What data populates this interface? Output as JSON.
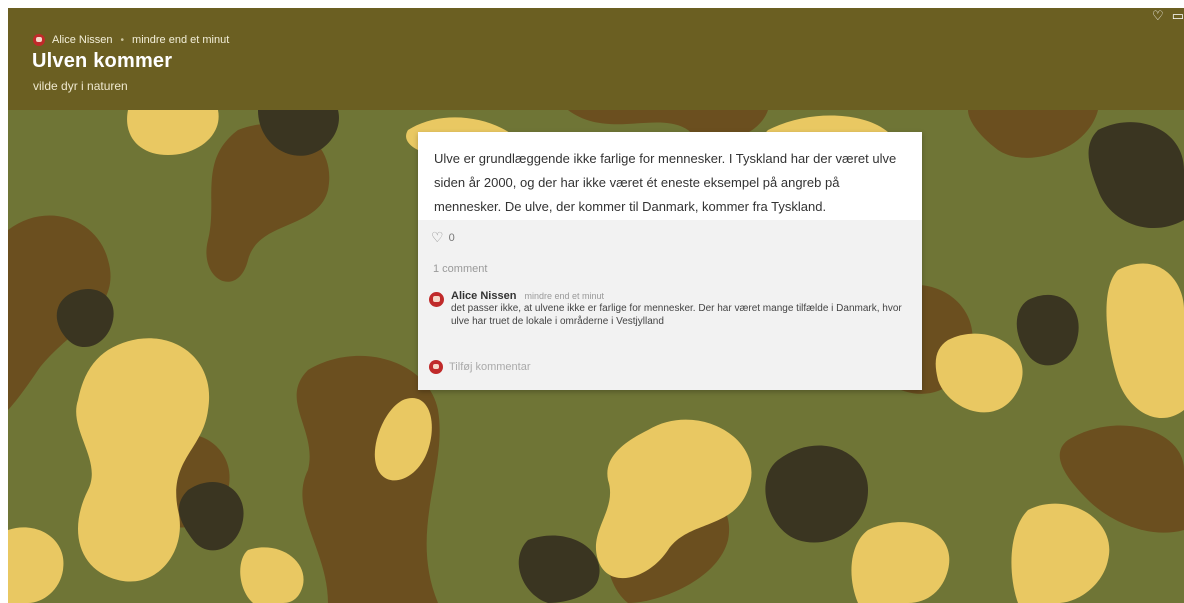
{
  "post": {
    "author": "Alice Nissen",
    "separator": "•",
    "time": "mindre end et minut",
    "title": "Ulven kommer",
    "subtitle": "vilde dyr i naturen"
  },
  "card": {
    "text": "Ulve er grundlæggende ikke farlige for mennesker. I Tyskland har der været ulve siden år 2000, og der har ikke været ét eneste eksempel på angreb på mennesker. De ulve, der kommer til Danmark, kommer fra Tyskland.",
    "likes": "0",
    "comment_count": "1 comment",
    "comments": [
      {
        "author": "Alice Nissen",
        "time": "mindre end et minut",
        "text": "det passer ikke, at ulvene ikke er farlige for mennesker. Der har været mange tilfælde i Danmark, hvor ulve har truet de lokale i områderne i Vestjylland"
      }
    ],
    "add_comment_placeholder": "Tilføj kommentar"
  },
  "icons": {
    "like": "heart-icon",
    "top_right": [
      "heart-icon",
      "comment-icon"
    ]
  },
  "colors": {
    "header": "#6b5f22",
    "camo_green": "#6f7536",
    "camo_brown": "#6b4f1f",
    "camo_dark": "#3a3521",
    "camo_yellow": "#e9c862",
    "avatar": "#c02a2a"
  }
}
